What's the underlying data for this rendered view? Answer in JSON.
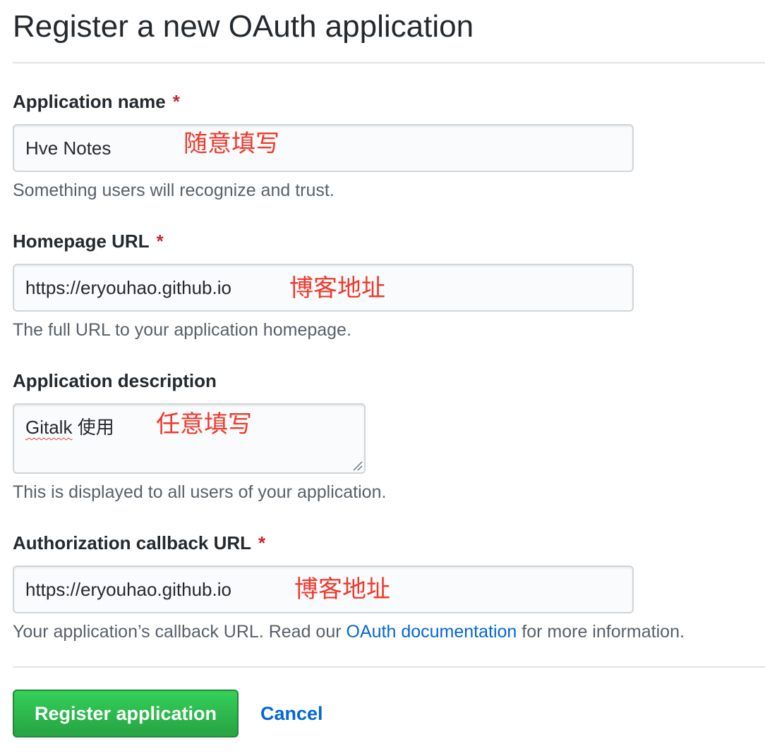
{
  "page": {
    "title": "Register a new OAuth application"
  },
  "fields": {
    "app_name": {
      "label": "Application name",
      "required_mark": "*",
      "value": "Hve Notes",
      "annotation": "随意填写",
      "note": "Something users will recognize and trust."
    },
    "homepage_url": {
      "label": "Homepage URL",
      "required_mark": "*",
      "value": "https://eryouhao.github.io",
      "annotation": "博客地址",
      "note": "The full URL to your application homepage."
    },
    "description": {
      "label": "Application description",
      "value_word": "Gitalk",
      "value_rest": " 使用",
      "annotation": "任意填写",
      "note": "This is displayed to all users of your application."
    },
    "callback_url": {
      "label": "Authorization callback URL",
      "required_mark": "*",
      "value": "https://eryouhao.github.io",
      "annotation": "博客地址",
      "note_before": "Your application’s callback URL. Read our ",
      "note_link": "OAuth documentation",
      "note_after": " for more information."
    }
  },
  "actions": {
    "register_label": "Register application",
    "cancel_label": "Cancel"
  },
  "colors": {
    "required": "#cb2431",
    "link": "#0366d6",
    "primary_button": "#28a745",
    "annotation": "#f0382b"
  }
}
